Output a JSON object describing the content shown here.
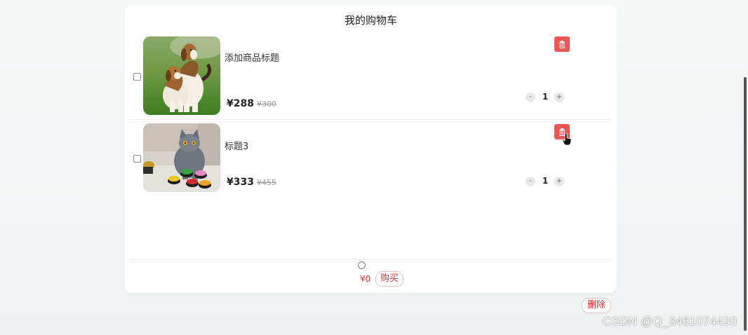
{
  "cart": {
    "title": "我的购物车",
    "items": [
      {
        "image": "beagle-dogs-photo",
        "title": "添加商品标题",
        "price": "¥288",
        "old_price": "¥300",
        "quantity": "1",
        "decrement": "-",
        "increment": "+"
      },
      {
        "image": "gray-cat-photo",
        "title": "标题3",
        "price": "¥333",
        "old_price": "¥455",
        "quantity": "1",
        "decrement": "-",
        "increment": "+"
      }
    ],
    "footer": {
      "total": "¥0",
      "buy_label": "购买"
    }
  },
  "delete_all_label": "删除",
  "watermark": "CSDN @Q_3461074420",
  "icons": {
    "delete": "trash-icon",
    "select_all": "radio-icon",
    "pointer": "hand-cursor-icon"
  },
  "colors": {
    "accent": "#d0323a",
    "delete_button": "#ee5555"
  }
}
